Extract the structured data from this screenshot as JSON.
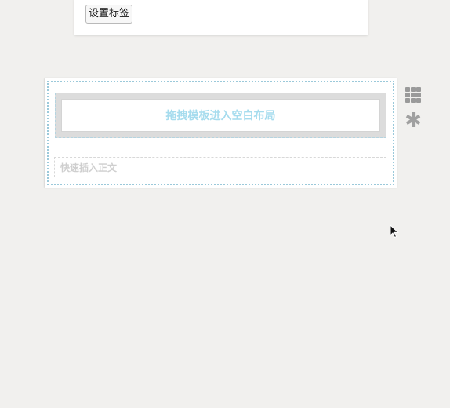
{
  "toolbar": {
    "set_tag_label": "设置标签"
  },
  "editor": {
    "drop_zone_label": "拖拽模板进入空白布局",
    "quick_insert_label": "快速插入正文"
  },
  "side_tools": {
    "grid_icon": "grid-icon",
    "asterisk_icon": "asterisk-icon",
    "asterisk_glyph": "✱"
  },
  "colors": {
    "background": "#f1f0ee",
    "drop_zone_text": "#a6dcee",
    "dotted_border": "#9bc9da"
  }
}
